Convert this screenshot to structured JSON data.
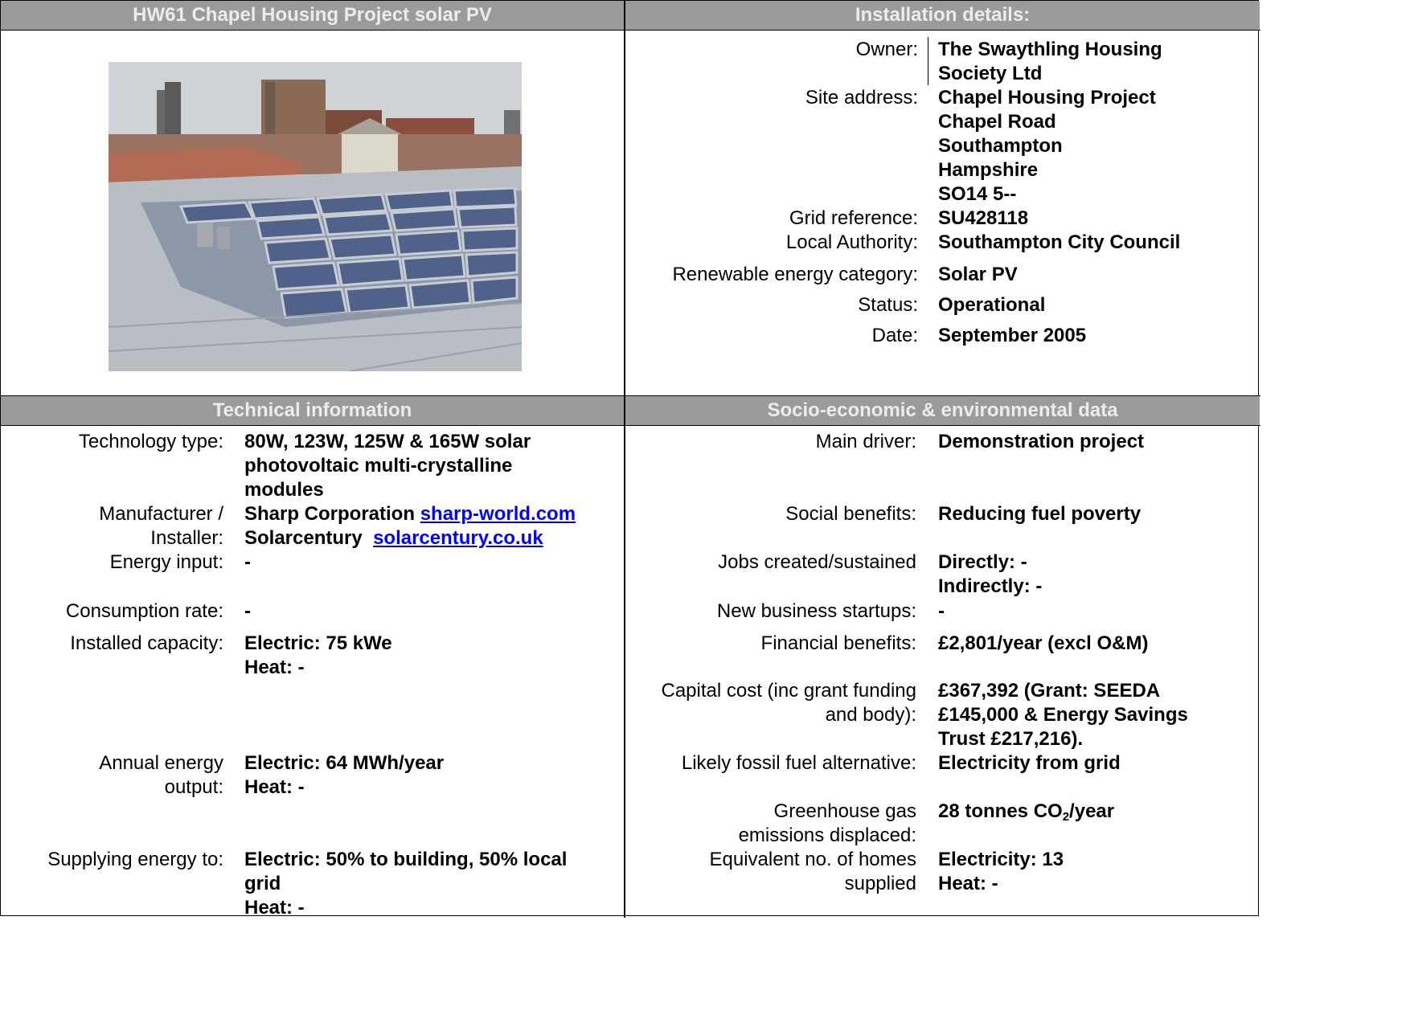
{
  "header": {
    "project_title": "HW61 Chapel Housing Project solar PV",
    "installation_title": "Installation details:",
    "technical_title": "Technical information",
    "socio_title": "Socio-economic & environmental data"
  },
  "installation": [
    {
      "label": "Owner:",
      "lines": [
        "The Swaythling Housing",
        "Society Ltd"
      ]
    },
    {
      "label": "Site address:",
      "lines": [
        "Chapel Housing Project",
        "Chapel Road",
        "Southampton",
        "Hampshire",
        "SO14 5--"
      ]
    },
    {
      "label": "Grid reference:",
      "lines": [
        "SU428118"
      ]
    },
    {
      "label": "Local Authority:",
      "lines": [
        "Southampton City Council"
      ]
    },
    {
      "label": "Renewable energy category:",
      "lines": [
        "Solar PV"
      ]
    },
    {
      "label": "Status:",
      "lines": [
        "Operational"
      ]
    },
    {
      "label": "Date:",
      "lines": [
        "September 2005"
      ]
    }
  ],
  "technical": {
    "technology_type": {
      "label": "Technology type:",
      "lines": [
        "80W, 123W, 125W & 165W solar",
        "photovoltaic multi-crystalline",
        "modules"
      ]
    },
    "manufacturer": {
      "label1": "Manufacturer /",
      "label2": "Installer:",
      "manufacturer_name": "Sharp Corporation",
      "manufacturer_link": "sharp-world.com",
      "installer_name": "Solarcentury",
      "installer_link": "solarcentury.co.uk"
    },
    "energy_input": {
      "label": "Energy input:",
      "value": "-"
    },
    "consumption_rate": {
      "label": "Consumption rate:",
      "value": "-"
    },
    "installed_capacity": {
      "label": "Installed capacity:",
      "lines": [
        "Electric: 75 kWe",
        "Heat: -"
      ]
    },
    "annual_output": {
      "label1": "Annual energy",
      "label2": "output:",
      "lines": [
        "Electric: 64 MWh/year",
        "Heat: -"
      ]
    },
    "supplying": {
      "label": "Supplying energy to:",
      "lines": [
        "Electric: 50% to building, 50% local",
        "grid",
        "Heat: -"
      ]
    }
  },
  "socio": {
    "main_driver": {
      "label": "Main driver:",
      "value": "Demonstration project"
    },
    "social_benefits": {
      "label": "Social benefits:",
      "value": "Reducing fuel poverty"
    },
    "jobs": {
      "label": "Jobs created/sustained",
      "lines": [
        "Directly: -",
        "Indirectly: -"
      ]
    },
    "startups": {
      "label": "New business startups:",
      "value": "-"
    },
    "financial": {
      "label": "Financial benefits:",
      "value": "£2,801/year (excl O&M)"
    },
    "capital": {
      "label1": "Capital cost (inc grant funding",
      "label2": "and body):",
      "lines": [
        "£367,392 (Grant: SEEDA",
        "£145,000 & Energy Savings",
        "Trust £217,216)."
      ]
    },
    "fossil": {
      "label": "Likely fossil fuel alternative:",
      "value": "Electricity from grid"
    },
    "ghg": {
      "label1": "Greenhouse gas",
      "label2": "emissions displaced:",
      "value_pre": "28 tonnes CO",
      "value_sub": "2",
      "value_post": "/year"
    },
    "homes": {
      "label1": "Equivalent no. of homes",
      "label2": "supplied",
      "lines": [
        "Electricity: 13",
        "Heat: -"
      ]
    }
  }
}
